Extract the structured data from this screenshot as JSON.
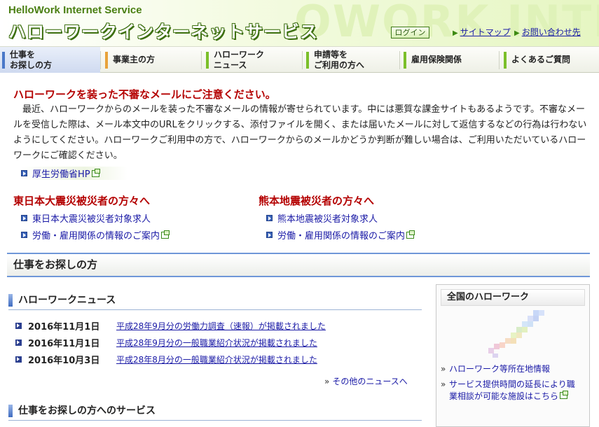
{
  "header": {
    "brand_en": "HelloWork Internet Service",
    "brand_ja": "ハローワークインターネットサービス",
    "watermark": "OWORK INTERNE",
    "login_label": "ログイン",
    "links": [
      {
        "label": "サイトマップ"
      },
      {
        "label": "お問い合わせ先"
      }
    ]
  },
  "nav": {
    "items": [
      {
        "line1": "仕事を",
        "line2": "お探しの方",
        "color": "#4a78c8"
      },
      {
        "line1": "事業主の方",
        "line2": "",
        "color": "#e8a23a"
      },
      {
        "line1": "ハローワーク",
        "line2": "ニュース",
        "color": "#7bbf2a"
      },
      {
        "line1": "申請等を",
        "line2": "ご利用の方へ",
        "color": "#7bbf2a"
      },
      {
        "line1": "雇用保険関係",
        "line2": "",
        "color": "#7bbf2a"
      },
      {
        "line1": "よくあるご質問",
        "line2": "",
        "color": "#7bbf2a"
      }
    ]
  },
  "alert": {
    "title": "ハローワークを装った不審なメールにご注意ください。",
    "body": "最近、ハローワークからのメールを装った不審なメールの情報が寄せられています。中には悪質な課金サイトもあるようです。不審なメールを受信した際は、メール本文中のURLをクリックする、添付ファイルを開く、または届いたメールに対して返信するなどの行為は行わないようにしてください。ハローワークご利用中の方で、ハローワークからのメールかどうか判断が難しい場合は、ご利用いただいているハローワークにご確認ください。",
    "link_label": "厚生労働省HP"
  },
  "quake": {
    "east_title": "東日本大震災被災者の方々へ",
    "east_links": [
      "東日本大震災被災者対象求人",
      "労働・雇用関係の情報のご案内"
    ],
    "kumamoto_title": "熊本地震被災者の方々へ",
    "kumamoto_links": [
      "熊本地震被災者対象求人",
      "労働・雇用関係の情報のご案内"
    ]
  },
  "section_title": "仕事をお探しの方",
  "news": {
    "heading": "ハローワークニュース",
    "items": [
      {
        "date": "2016年11月1日",
        "title": "平成28年9月分の労働力調査（速報）が掲載されました"
      },
      {
        "date": "2016年11月1日",
        "title": "平成28年9月分の一般職業紹介状況が掲載されました"
      },
      {
        "date": "2016年10月3日",
        "title": "平成28年8月分の一般職業紹介状況が掲載されました"
      }
    ],
    "more_label": "その他のニュースへ"
  },
  "services_heading": "仕事をお探しの方へのサービス",
  "side": {
    "title": "全国のハローワーク",
    "links": [
      "ハローワーク等所在地情報",
      "サービス提供時間の延長により職業相談が可能な施設はこちら"
    ]
  },
  "colors": {
    "brand_green": "#3c6f0e",
    "alert_red": "#b40000",
    "link_blue": "#1a1aa6",
    "section_blue": "#6f97d8"
  }
}
